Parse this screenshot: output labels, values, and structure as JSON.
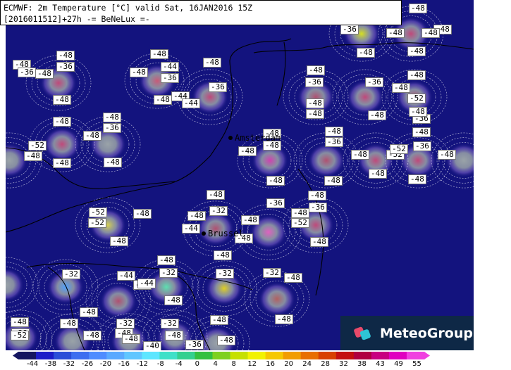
{
  "title": {
    "line1": "ECMWF: 2m Temperature [°C] valid Sat, 16JAN2016 15Z",
    "line2": "[2016011512]+27h -= BeNeLux =-"
  },
  "cities": [
    {
      "name": "Amsterdam"
    },
    {
      "name": "Brussel"
    }
  ],
  "logo": {
    "text": "MeteoGroup"
  },
  "colors": {
    "background": "#13137e",
    "coast": "#000000",
    "logo_bg": "#0e2846",
    "logo_mark_a": "#e84a6a",
    "logo_mark_b": "#2ec4d6"
  },
  "colorbar": {
    "labels": [
      "-44",
      "-38",
      "-32",
      "-26",
      "-20",
      "-16",
      "-12",
      "-8",
      "-4",
      "0",
      "4",
      "8",
      "12",
      "16",
      "20",
      "24",
      "28",
      "32",
      "38",
      "43",
      "49",
      "55"
    ],
    "colors": [
      "#151560",
      "#1c1cc8",
      "#2a4dd8",
      "#3d6ef0",
      "#4f8cff",
      "#5aa9ff",
      "#60c6ff",
      "#5ee6ff",
      "#3fe0c8",
      "#34d090",
      "#33c040",
      "#7ed020",
      "#c6e000",
      "#f2f200",
      "#f6c800",
      "#f29d00",
      "#e86e00",
      "#d84000",
      "#c41010",
      "#b00040",
      "#c80080",
      "#e000c0",
      "#f040e0"
    ]
  },
  "labels": [
    {
      "text": "-48"
    },
    {
      "text": "-48"
    },
    {
      "text": "-52"
    },
    {
      "text": "-48"
    },
    {
      "text": "-48"
    },
    {
      "text": "-48"
    },
    {
      "text": "-36"
    },
    {
      "text": "-48"
    },
    {
      "text": "-36"
    },
    {
      "text": "-48"
    },
    {
      "text": "-48"
    },
    {
      "text": "-36"
    },
    {
      "text": "-48"
    },
    {
      "text": "-48"
    },
    {
      "text": "-44"
    },
    {
      "text": "-44"
    },
    {
      "text": "-36"
    },
    {
      "text": "-48"
    },
    {
      "text": "-48"
    },
    {
      "text": "-44"
    },
    {
      "text": "-36"
    },
    {
      "text": "-48"
    },
    {
      "text": "-48"
    },
    {
      "text": "-36"
    },
    {
      "text": "-48"
    },
    {
      "text": "-48"
    },
    {
      "text": "-48"
    },
    {
      "text": "-36"
    },
    {
      "text": "-48"
    },
    {
      "text": "-48"
    },
    {
      "text": "-48"
    },
    {
      "text": "-48"
    },
    {
      "text": "-52"
    },
    {
      "text": "-36"
    },
    {
      "text": "-48"
    },
    {
      "text": "-52"
    },
    {
      "text": "-48"
    },
    {
      "text": "-48"
    },
    {
      "text": "-48"
    },
    {
      "text": "-48"
    },
    {
      "text": "-36"
    },
    {
      "text": "-48"
    },
    {
      "text": "-48"
    },
    {
      "text": "-48"
    },
    {
      "text": "-36"
    },
    {
      "text": "-48"
    },
    {
      "text": "-52"
    },
    {
      "text": "-48"
    },
    {
      "text": "-48"
    },
    {
      "text": "-48"
    },
    {
      "text": "-36"
    },
    {
      "text": "-48"
    },
    {
      "text": "-48"
    },
    {
      "text": "-48"
    },
    {
      "text": "-48"
    },
    {
      "text": "-48"
    },
    {
      "text": "-52"
    },
    {
      "text": "-52"
    },
    {
      "text": "-48"
    },
    {
      "text": "-48"
    },
    {
      "text": "-32"
    },
    {
      "text": "-48"
    },
    {
      "text": "-44"
    },
    {
      "text": "-48"
    },
    {
      "text": "-36"
    },
    {
      "text": "-48"
    },
    {
      "text": "-48"
    },
    {
      "text": "-48"
    },
    {
      "text": "-52"
    },
    {
      "text": "-36"
    },
    {
      "text": "-48"
    },
    {
      "text": "-48"
    },
    {
      "text": "-32"
    },
    {
      "text": "-44"
    },
    {
      "text": "-44"
    },
    {
      "text": "-48"
    },
    {
      "text": "-32"
    },
    {
      "text": "-44"
    },
    {
      "text": "-48"
    },
    {
      "text": "-32"
    },
    {
      "text": "-48"
    },
    {
      "text": "-32"
    },
    {
      "text": "-48"
    },
    {
      "text": "-48"
    },
    {
      "text": "-48"
    },
    {
      "text": "-48"
    },
    {
      "text": "-38"
    },
    {
      "text": "-52"
    },
    {
      "text": "-32"
    },
    {
      "text": "-48"
    },
    {
      "text": "-48"
    },
    {
      "text": "-40"
    },
    {
      "text": "-48"
    },
    {
      "text": "-48"
    },
    {
      "text": "-32"
    },
    {
      "text": "-48"
    },
    {
      "text": "-36"
    },
    {
      "text": "-48"
    },
    {
      "text": "-48"
    }
  ]
}
